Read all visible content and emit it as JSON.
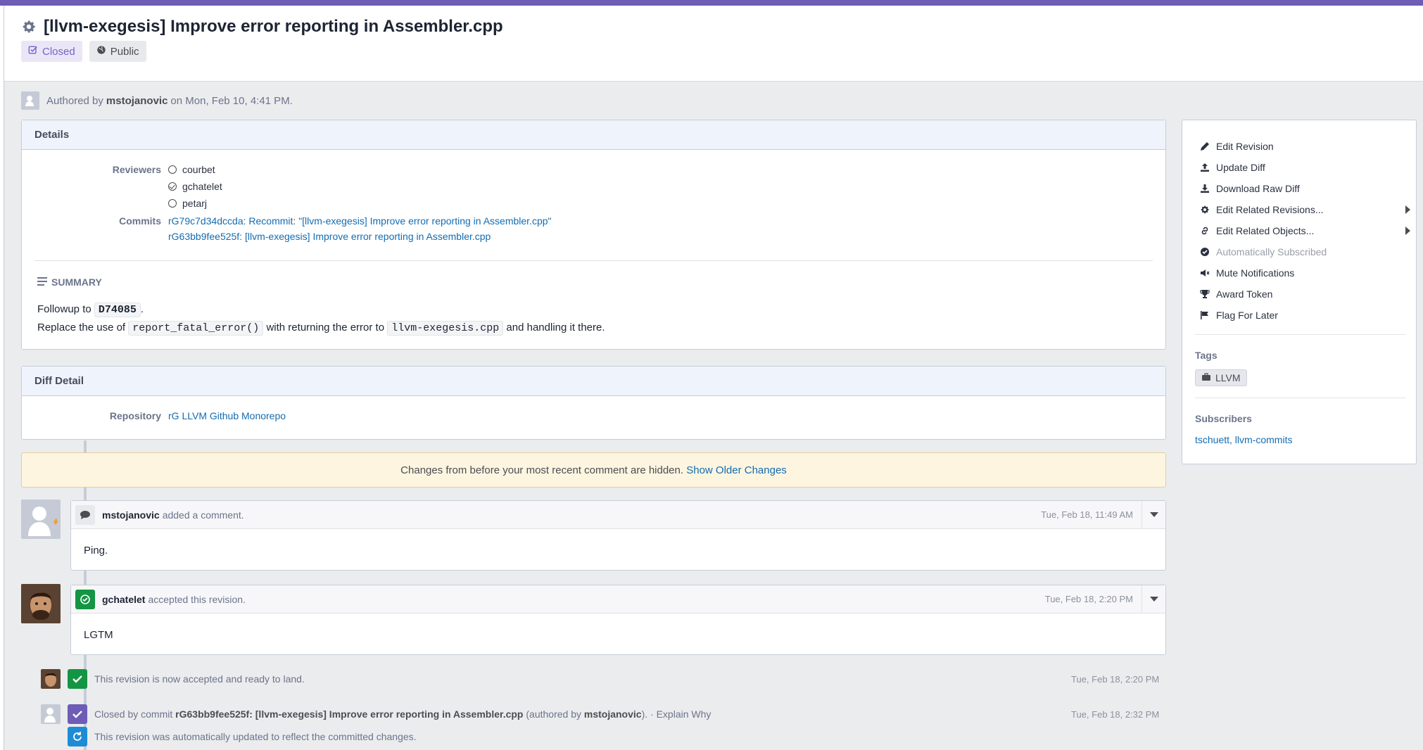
{
  "header": {
    "title": "[llvm-exegesis] Improve error reporting in Assembler.cpp",
    "status_label": "Closed",
    "visibility_label": "Public"
  },
  "authored": {
    "prefix": "Authored by",
    "author": "mstojanovic",
    "suffix": "on Mon, Feb 10, 4:41 PM."
  },
  "details": {
    "title": "Details",
    "reviewers_label": "Reviewers",
    "reviewers": [
      {
        "name": "courbet",
        "status": "pending"
      },
      {
        "name": "gchatelet",
        "status": "accepted"
      },
      {
        "name": "petarj",
        "status": "pending"
      }
    ],
    "commits_label": "Commits",
    "commits": [
      "rG79c7d34dccda: Recommit: \"[llvm-exegesis] Improve error reporting in Assembler.cpp\"",
      "rG63bb9fee525f: [llvm-exegesis] Improve error reporting in Assembler.cpp"
    ],
    "summary_label": "SUMMARY",
    "summary": {
      "line1_prefix": "Followup to",
      "line1_ref": "D74085",
      "line1_suffix": ".",
      "line2_a": "Replace the use of",
      "line2_code1": "report_fatal_error()",
      "line2_b": "with returning the error to",
      "line2_code2": "llvm-exegesis.cpp",
      "line2_c": "and handling it there."
    }
  },
  "diff_detail": {
    "title": "Diff Detail",
    "repository_label": "Repository",
    "repository_value": "rG LLVM Github Monorepo"
  },
  "banner": {
    "text": "Changes from before your most recent comment are hidden.",
    "link": "Show Older Changes"
  },
  "timeline": {
    "comment1": {
      "author": "mstojanovic",
      "action": "added a comment.",
      "time": "Tue, Feb 18, 11:49 AM",
      "body": "Ping."
    },
    "comment2": {
      "author": "gchatelet",
      "action": "accepted this revision.",
      "time": "Tue, Feb 18, 2:20 PM",
      "body": "LGTM"
    },
    "event1": {
      "text": "This revision is now accepted and ready to land.",
      "time": "Tue, Feb 18, 2:20 PM"
    },
    "event2": {
      "prefix": "Closed by commit",
      "commit": "rG63bb9fee525f: [llvm-exegesis] Improve error reporting in Assembler.cpp",
      "mid": "(authored by",
      "author": "mstojanovic",
      "end": ").",
      "sep": "·",
      "explain": "Explain Why",
      "time": "Tue, Feb 18, 2:32 PM"
    },
    "event3": {
      "text": "This revision was automatically updated to reflect the committed changes."
    }
  },
  "sidebar": {
    "actions": [
      {
        "label": "Edit Revision",
        "icon": "pencil-icon"
      },
      {
        "label": "Update Diff",
        "icon": "upload-icon"
      },
      {
        "label": "Download Raw Diff",
        "icon": "download-icon"
      },
      {
        "label": "Edit Related Revisions...",
        "icon": "gear-icon"
      },
      {
        "label": "Edit Related Objects...",
        "icon": "link-icon"
      },
      {
        "label": "Automatically Subscribed",
        "icon": "check-circle-icon"
      },
      {
        "label": "Mute Notifications",
        "icon": "volume-off-icon"
      },
      {
        "label": "Award Token",
        "icon": "trophy-icon"
      },
      {
        "label": "Flag For Later",
        "icon": "flag-icon"
      }
    ],
    "tags_label": "Tags",
    "tag": "LLVM",
    "subscribers_label": "Subscribers",
    "subscribers": "tschuett, llvm-commits"
  },
  "colors": {
    "accent_purple": "#6e5cb6",
    "link_blue": "#136cb2",
    "accept_green": "#139543",
    "close_purple": "#6e5cb6",
    "update_blue": "#1e8bd6"
  }
}
